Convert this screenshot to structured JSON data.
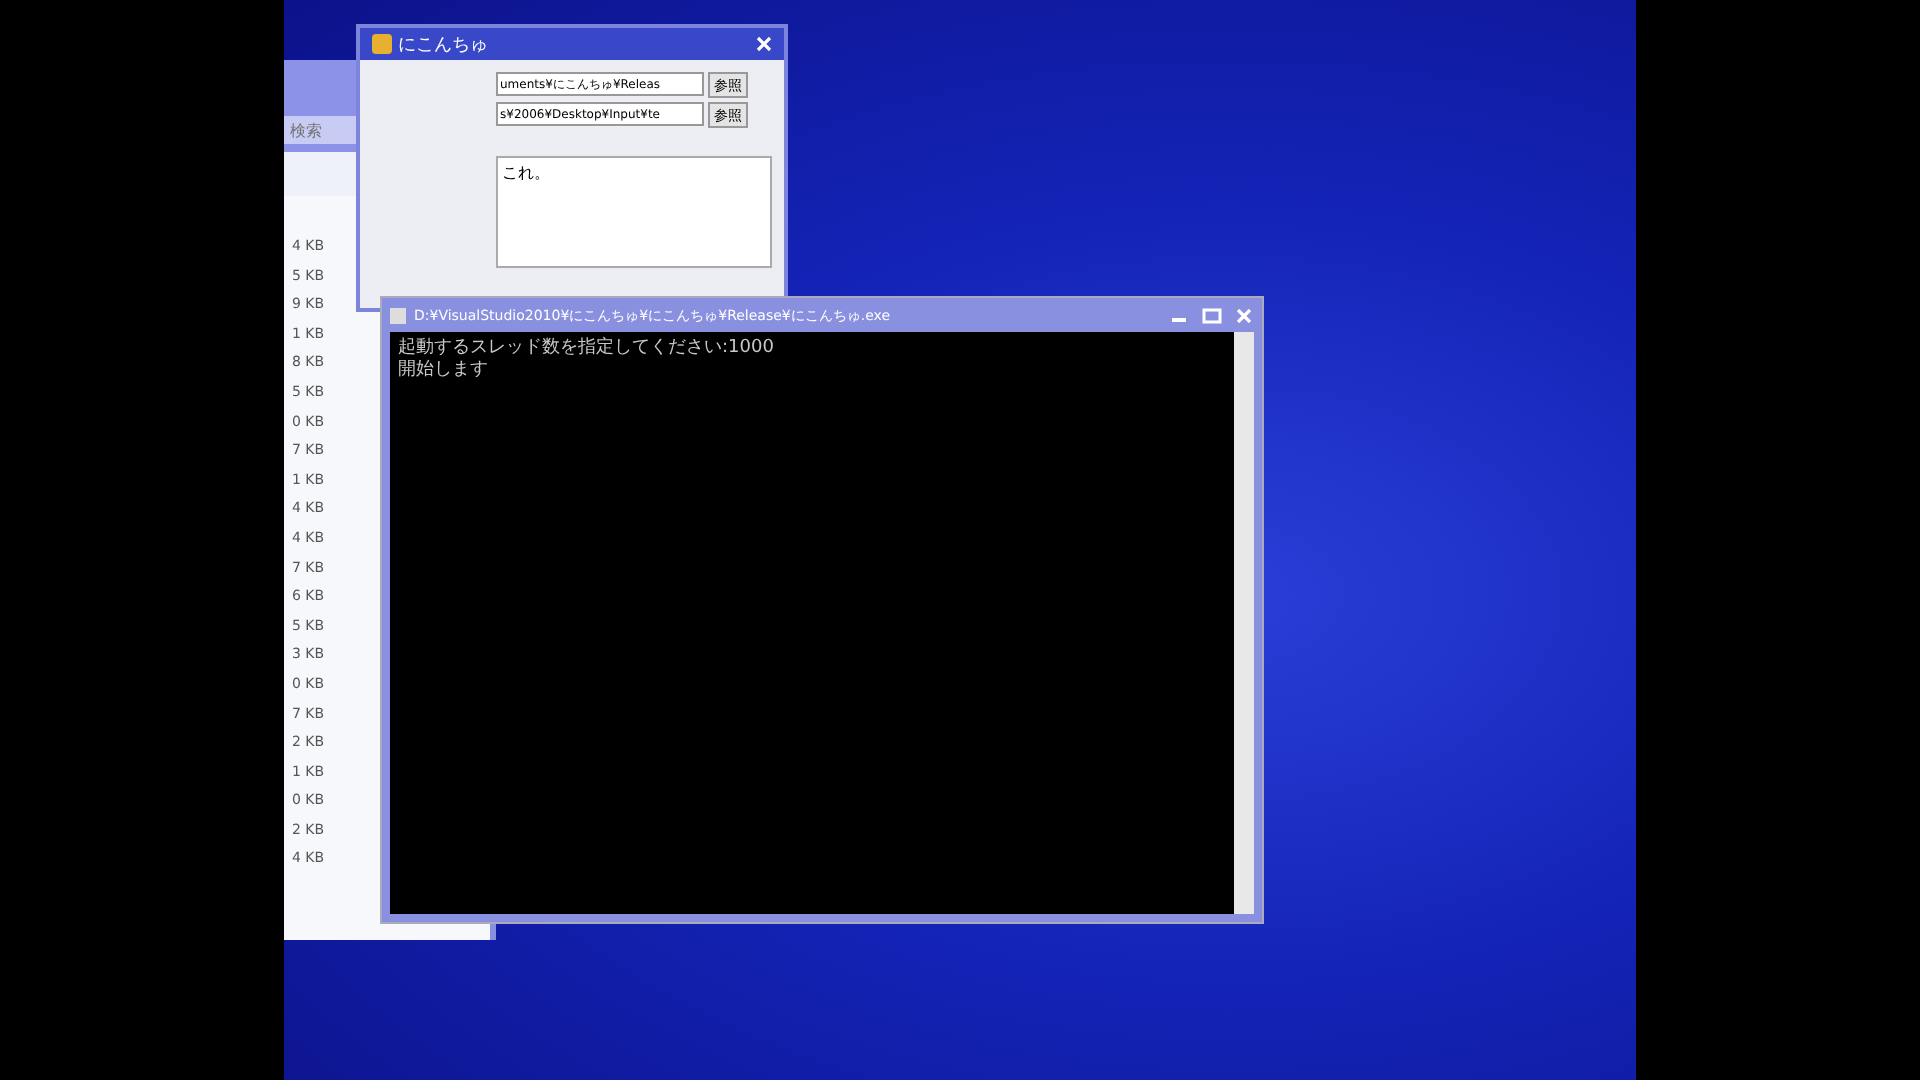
{
  "explorer": {
    "search": {
      "placeholder": "検索"
    },
    "sizes": [
      "4 KB",
      "5 KB",
      "9 KB",
      "1 KB",
      "8 KB",
      "5 KB",
      "0 KB",
      "7 KB",
      "1 KB",
      "4 KB",
      "4 KB",
      "7 KB",
      "6 KB",
      "5 KB",
      "3 KB",
      "0 KB",
      "7 KB",
      "2 KB",
      "1 KB",
      "0 KB",
      "2 KB",
      "4 KB"
    ]
  },
  "dialog": {
    "title": "にこんちゅ",
    "fields": [
      {
        "value": "uments¥にこんちゅ¥Releas",
        "button": "参照"
      },
      {
        "value": "s¥2006¥Desktop¥Input¥te",
        "button": "参照"
      }
    ],
    "text": "これ。"
  },
  "console": {
    "title": "D:¥VisualStudio2010¥にこんちゅ¥にこんちゅ¥Release¥にこんちゅ.exe",
    "lines": [
      "起動するスレッド数を指定してください:1000",
      "開始します"
    ]
  }
}
